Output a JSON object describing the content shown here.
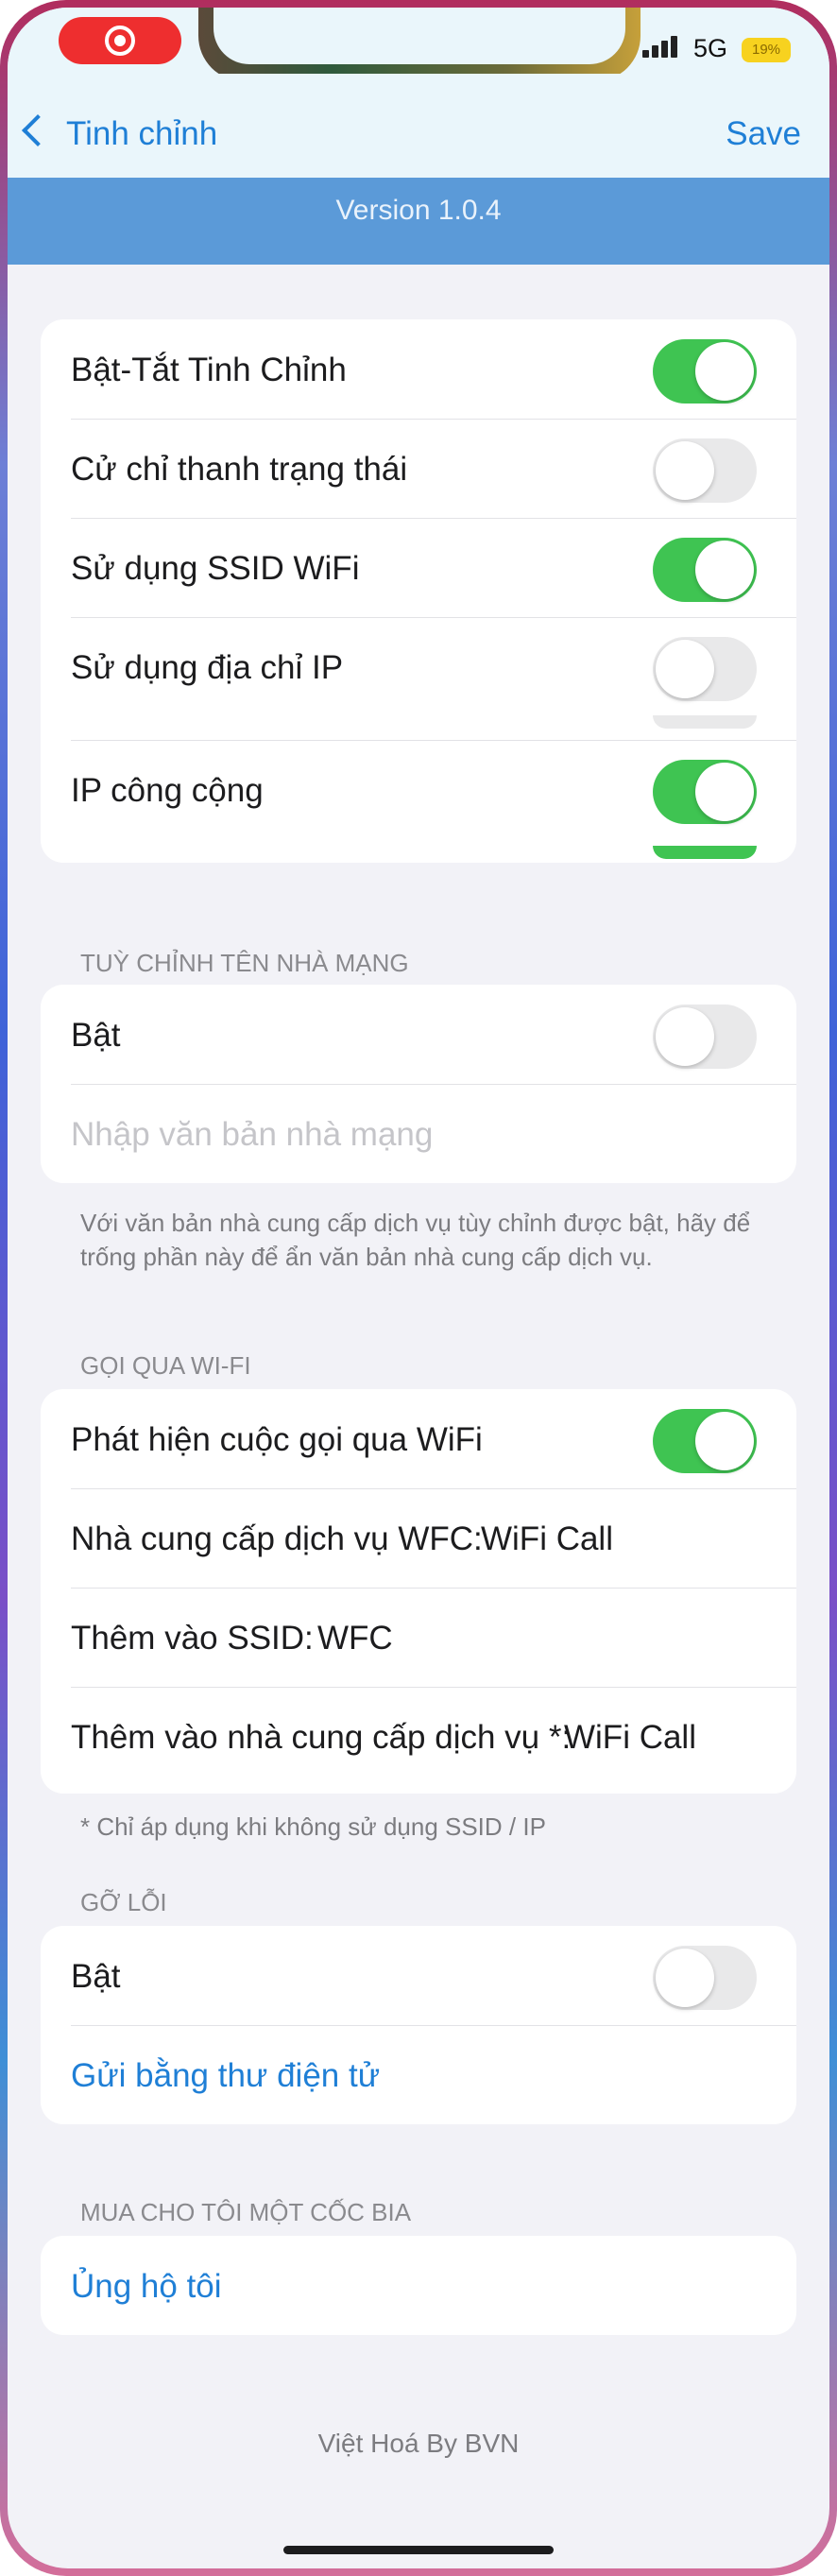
{
  "status_bar": {
    "network": "5G",
    "battery": "19%"
  },
  "nav": {
    "back_label": "Tinh chỉnh",
    "save_label": "Save"
  },
  "version": "Version 1.0.4",
  "general": {
    "rows": [
      {
        "label": "Bật-Tắt Tinh Chỉnh",
        "on": true
      },
      {
        "label": "Cử chỉ thanh trạng thái",
        "on": false
      },
      {
        "label": "Sử dụng SSID WiFi",
        "on": true
      },
      {
        "label": "Sử dụng địa chỉ IP",
        "on": false
      },
      {
        "label": "IP công cộng",
        "on": true
      }
    ]
  },
  "carrier": {
    "header": "TUỲ CHỈNH TÊN NHÀ MẠNG",
    "enable_label": "Bật",
    "enable_on": false,
    "input_placeholder": "Nhập văn bản nhà mạng",
    "footnote": "Với văn bản nhà cung cấp dịch vụ tùy chỉnh được bật, hãy để trống phần này để ẩn văn bản nhà cung cấp dịch vụ."
  },
  "wifi_calling": {
    "header": "GỌI QUA WI-FI",
    "detect_label": "Phát hiện cuộc gọi qua WiFi",
    "detect_on": true,
    "wfc_provider_label": "Nhà cung cấp dịch vụ WFC:",
    "wfc_provider_value": "WiFi Call",
    "ssid_label": "Thêm vào SSID:",
    "ssid_value": "WFC",
    "carrier_label": "Thêm vào nhà cung cấp dịch vụ *:",
    "carrier_value": "WiFi Call",
    "footnote": "* Chỉ áp dụng khi không sử dụng SSID / IP"
  },
  "debug": {
    "header": "GỠ LỖI",
    "enable_label": "Bật",
    "enable_on": false,
    "email_label": "Gửi bằng thư điện tử"
  },
  "beer": {
    "header": "MUA CHO TÔI MỘT CỐC BIA",
    "support_label": "Ủng hộ tôi"
  },
  "credit": "Việt Hoá By BVN"
}
